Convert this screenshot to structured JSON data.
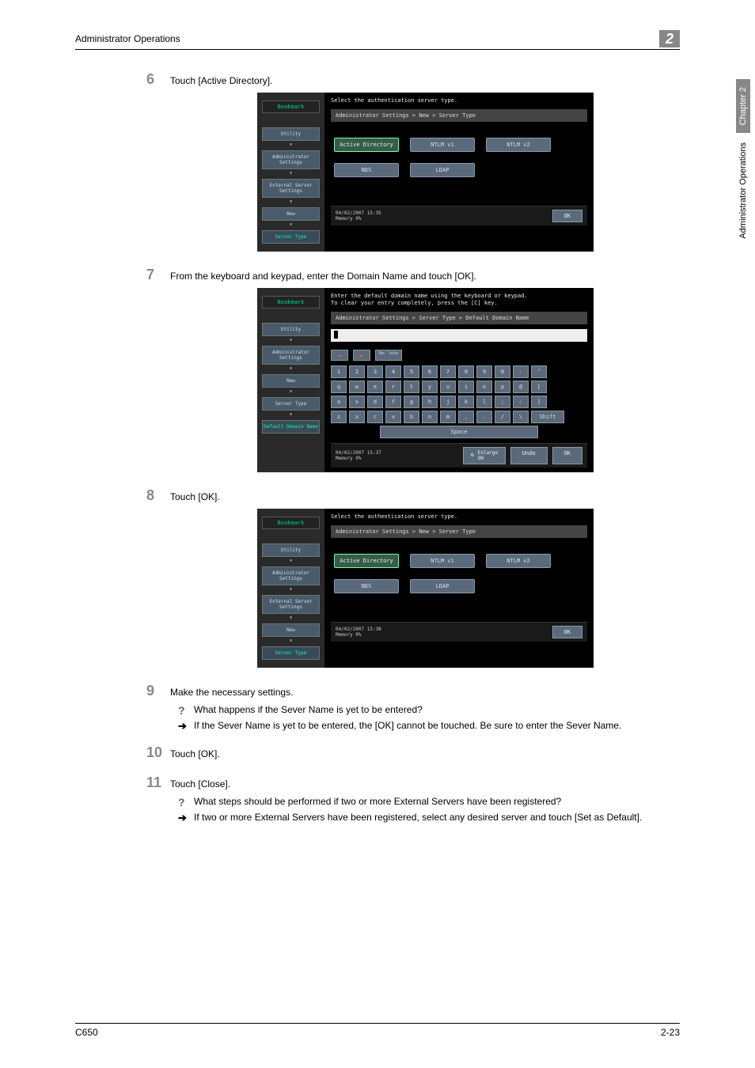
{
  "header": {
    "title": "Administrator Operations",
    "chapter_badge": "2"
  },
  "side_tab": {
    "chapter": "Chapter 2",
    "title": "Administrator Operations"
  },
  "footer": {
    "left": "C650",
    "right": "2-23"
  },
  "steps": {
    "s6": {
      "num": "6",
      "text": "Touch [Active Directory]."
    },
    "s7": {
      "num": "7",
      "text": "From the keyboard and keypad, enter the Domain Name and touch [OK]."
    },
    "s8": {
      "num": "8",
      "text": "Touch [OK]."
    },
    "s9": {
      "num": "9",
      "text": "Make the necessary settings.",
      "q": "What happens if the Sever Name is yet to be entered?",
      "a": "If the Sever Name is yet to be entered, the [OK] cannot be touched. Be sure to enter the Sever Name."
    },
    "s10": {
      "num": "10",
      "text": "Touch [OK]."
    },
    "s11": {
      "num": "11",
      "text": "Touch [Close].",
      "q": "What steps should be performed if two or more External Servers have been registered?",
      "a": "If two or more External Servers have been registered, select any desired server and touch [Set as Default]."
    }
  },
  "screen1": {
    "bookmark": "Bookmark",
    "crumbs": [
      "Utility",
      "Administrator Settings",
      "External Server Settings",
      "New",
      "Server Type"
    ],
    "instr": "Select the authentication server type.",
    "path": "Administrator Settings > New > Server Type",
    "buttons_row1": [
      "Active Directory",
      "NTLM v1",
      "NTLM v2"
    ],
    "buttons_row2": [
      "NDS",
      "LDAP"
    ],
    "footer_time": "04/02/2007   15:35",
    "footer_mem": "Memory        0%",
    "ok": "OK"
  },
  "screen2": {
    "bookmark": "Bookmark",
    "crumbs": [
      "Utility",
      "Administrator Settings",
      "New",
      "Server Type",
      "Default Domain Name"
    ],
    "instr1": "Enter the default domain name using the keyboard or keypad.",
    "instr2": "To clear your entry completely, press the [C] key.",
    "path": "Administrator Settings > Server Type > Default Domain Name",
    "kbd_del": "De-\nlete",
    "row1": [
      "1",
      "2",
      "3",
      "4",
      "5",
      "6",
      "7",
      "8",
      "9",
      "0",
      "-",
      "^"
    ],
    "row2": [
      "q",
      "w",
      "e",
      "r",
      "t",
      "y",
      "u",
      "i",
      "o",
      "p",
      "@",
      "["
    ],
    "row3": [
      "a",
      "s",
      "d",
      "f",
      "g",
      "h",
      "j",
      "k",
      "l",
      ";",
      ":",
      "]"
    ],
    "row4": [
      "z",
      "x",
      "c",
      "v",
      "b",
      "n",
      "m",
      ",",
      ".",
      "/",
      "\\"
    ],
    "shift": "Shift",
    "space": "Space",
    "footer_time": "04/02/2007   15:37",
    "footer_mem": "Memory        0%",
    "enlarge": "Enlarge ON",
    "undo": "Undo",
    "ok": "OK"
  },
  "screen3": {
    "bookmark": "Bookmark",
    "crumbs": [
      "Utility",
      "Administrator Settings",
      "External Server Settings",
      "New",
      "Server Type"
    ],
    "instr": "Select the authentication server type.",
    "path": "Administrator Settings > New > Server Type",
    "buttons_row1": [
      "Active Directory",
      "NTLM v1",
      "NTLM v2"
    ],
    "buttons_row2": [
      "NDS",
      "LDAP"
    ],
    "footer_time": "04/02/2007   15:38",
    "footer_mem": "Memory        0%",
    "ok": "OK"
  }
}
